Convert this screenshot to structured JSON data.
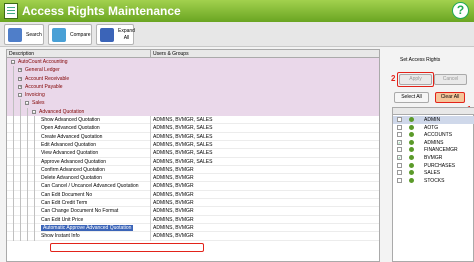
{
  "window": {
    "title": "Access Rights Maintenance",
    "help_glyph": "?"
  },
  "toolbar": [
    {
      "label": "Search",
      "icon": "search-icon",
      "color": "#4f7ec9"
    },
    {
      "label": "Compare",
      "icon": "compare-icon",
      "color": "#49a0d6"
    },
    {
      "label": "Expand All",
      "line1": "Expand",
      "line2": "All",
      "icon": "expand-icon",
      "color": "#3b64b8"
    }
  ],
  "grid": {
    "col_description": "Description",
    "col_users": "Users & Groups",
    "rows": [
      {
        "type": "cat",
        "level": 0,
        "toggle": "-",
        "label": "AutoCount Accounting",
        "users": ""
      },
      {
        "type": "cat",
        "level": 1,
        "toggle": "+",
        "label": "General Ledger",
        "users": ""
      },
      {
        "type": "cat",
        "level": 1,
        "toggle": "+",
        "label": "Account Receivable",
        "users": ""
      },
      {
        "type": "cat",
        "level": 1,
        "toggle": "+",
        "label": "Account Payable",
        "users": ""
      },
      {
        "type": "cat",
        "level": 1,
        "toggle": "-",
        "label": "Invoicing",
        "users": ""
      },
      {
        "type": "cat",
        "level": 2,
        "toggle": "-",
        "label": "Sales",
        "users": ""
      },
      {
        "type": "cat",
        "level": 3,
        "toggle": "-",
        "label": "Advanced Quotation",
        "users": ""
      },
      {
        "type": "perm",
        "label": "Show Advanced Quotation",
        "users": "ADMINS, BVMGR, SALES"
      },
      {
        "type": "perm",
        "label": "Open Advanced Quotation",
        "users": "ADMINS, BVMGR, SALES"
      },
      {
        "type": "perm",
        "label": "Create Advanced Quotation",
        "users": "ADMINS, BVMGR, SALES"
      },
      {
        "type": "perm",
        "label": "Edit Advanced Quotation",
        "users": "ADMINS, BVMGR, SALES"
      },
      {
        "type": "perm",
        "label": "View Advanced Quotation",
        "users": "ADMINS, BVMGR, SALES"
      },
      {
        "type": "perm",
        "label": "Approve Advanced Quotation",
        "users": "ADMINS, BVMGR, SALES"
      },
      {
        "type": "perm",
        "label": "Confirm Advanced Quotation",
        "users": "ADMINS, BVMGR"
      },
      {
        "type": "perm",
        "label": "Delete Advanced Quotation",
        "users": "ADMINS, BVMGR"
      },
      {
        "type": "perm",
        "label": "Can Cancel / Uncancel Advanced Quotation",
        "users": "ADMINS, BVMGR"
      },
      {
        "type": "perm",
        "label": "Can Edit Document No",
        "users": "ADMINS, BVMGR"
      },
      {
        "type": "perm",
        "label": "Can Edit Credit Term",
        "users": "ADMINS, BVMGR"
      },
      {
        "type": "perm",
        "label": "Can Change Document No Format",
        "users": "ADMINS, BVMGR"
      },
      {
        "type": "perm",
        "label": "Can Edit Unit Price",
        "users": "ADMINS, BVMGR"
      },
      {
        "type": "perm",
        "label": "Automatic Approve Advanced Quotation",
        "users": "ADMINS, BVMGR",
        "selected": true
      },
      {
        "type": "perm",
        "label": "Show Instant Info",
        "users": "ADMINS, BVMGR"
      }
    ]
  },
  "rights_panel": {
    "title": "Set Access Rights",
    "apply_label": "Apply",
    "cancel_label": "Cancel",
    "select_all_label": "Select All",
    "clear_all_label": "Clear All",
    "callout_step1": "1",
    "callout_step2": "2"
  },
  "users": [
    {
      "name": "ADMIN",
      "checked": false,
      "selected": true
    },
    {
      "name": "AOTG",
      "checked": false
    },
    {
      "name": "ACCOUNTS",
      "checked": false
    },
    {
      "name": "ADMINS",
      "checked": true
    },
    {
      "name": "FINANCEMGR",
      "checked": false
    },
    {
      "name": "BVMGR",
      "checked": true
    },
    {
      "name": "PURCHASES",
      "checked": false
    },
    {
      "name": "SALES",
      "checked": false
    },
    {
      "name": "STOCKS",
      "checked": false
    }
  ]
}
